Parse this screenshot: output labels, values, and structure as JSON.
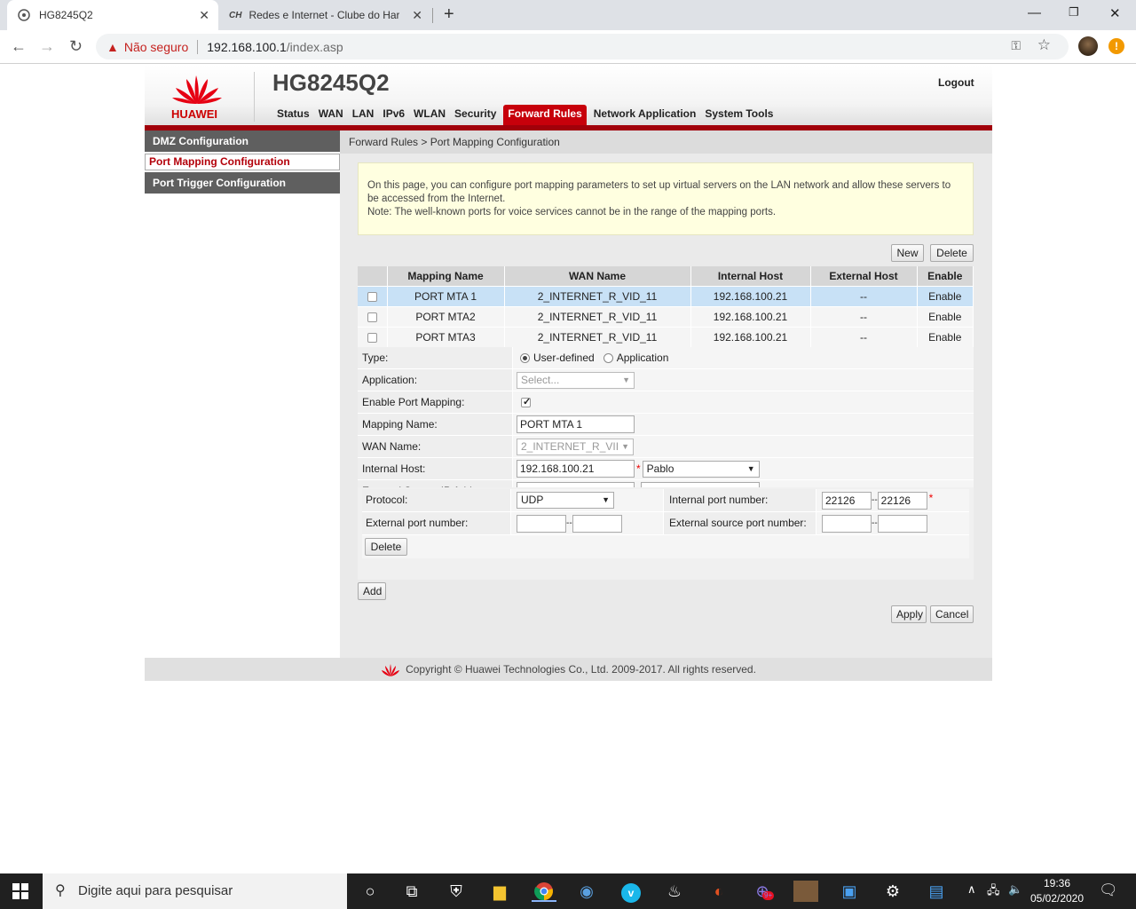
{
  "browser": {
    "tabs": [
      {
        "title": "HG8245Q2"
      },
      {
        "title": "Redes e Internet - Clube do Hardw"
      }
    ],
    "tab2_favicon_text": "CH",
    "security_label": "Não seguro",
    "url_host": "192.168.100.1",
    "url_path": "/index.asp"
  },
  "router": {
    "brand": "HUAWEI",
    "model": "HG8245Q2",
    "logout": "Logout",
    "nav": [
      "Status",
      "WAN",
      "LAN",
      "IPv6",
      "WLAN",
      "Security",
      "Forward Rules",
      "Network Application",
      "System Tools"
    ],
    "active_nav": "Forward Rules",
    "sidebar": [
      "DMZ Configuration",
      "Port Mapping Configuration",
      "Port Trigger Configuration"
    ],
    "breadcrumb": "Forward Rules > Port Mapping Configuration",
    "notice_line1": "On this page, you can configure port mapping parameters to set up virtual servers on the LAN network and allow these servers to be accessed from the Internet.",
    "notice_line2": "Note: The well-known ports for voice services cannot be in the range of the mapping ports.",
    "new_label": "New",
    "delete_label": "Delete",
    "table": {
      "headers": [
        "Mapping Name",
        "WAN Name",
        "Internal Host",
        "External Host",
        "Enable"
      ],
      "rows": [
        {
          "name": "PORT MTA 1",
          "wan": "2_INTERNET_R_VID_11",
          "host": "192.168.100.21",
          "ext": "--",
          "enable": "Enable"
        },
        {
          "name": "PORT MTA2",
          "wan": "2_INTERNET_R_VID_11",
          "host": "192.168.100.21",
          "ext": "--",
          "enable": "Enable"
        },
        {
          "name": "PORT MTA3",
          "wan": "2_INTERNET_R_VID_11",
          "host": "192.168.100.21",
          "ext": "--",
          "enable": "Enable"
        }
      ]
    },
    "form": {
      "type_label": "Type:",
      "type_opt1": "User-defined",
      "type_opt2": "Application",
      "app_label": "Application:",
      "app_value": "Select...",
      "enable_label": "Enable Port Mapping:",
      "mapname_label": "Mapping Name:",
      "mapname_value": "PORT MTA 1",
      "wan_label": "WAN Name:",
      "wan_value": "2_INTERNET_R_VII",
      "host_label": "Internal Host:",
      "host_value": "192.168.100.21",
      "host_device": "Pablo",
      "ext_src_label": "External Source IP Address:",
      "dash": "--",
      "req": "*"
    },
    "ports": {
      "protocol_label": "Protocol:",
      "protocol_value": "UDP",
      "int_port_label": "Internal port number:",
      "int_port_start": "22126",
      "int_port_end": "22126",
      "ext_port_label": "External port number:",
      "ext_src_port_label": "External source port number:",
      "delete_label": "Delete"
    },
    "add_label": "Add",
    "apply_label": "Apply",
    "cancel_label": "Cancel",
    "copyright": "Copyright © Huawei Technologies Co., Ltd. 2009-2017. All rights reserved."
  },
  "taskbar": {
    "search_placeholder": "Digite aqui para pesquisar",
    "time": "19:36",
    "date": "05/02/2020",
    "badge": "9+"
  },
  "colors": {
    "huawei_red": "#c7000b",
    "dark_red": "#a1000a",
    "chrome_tabbar": "#dee1e6"
  }
}
